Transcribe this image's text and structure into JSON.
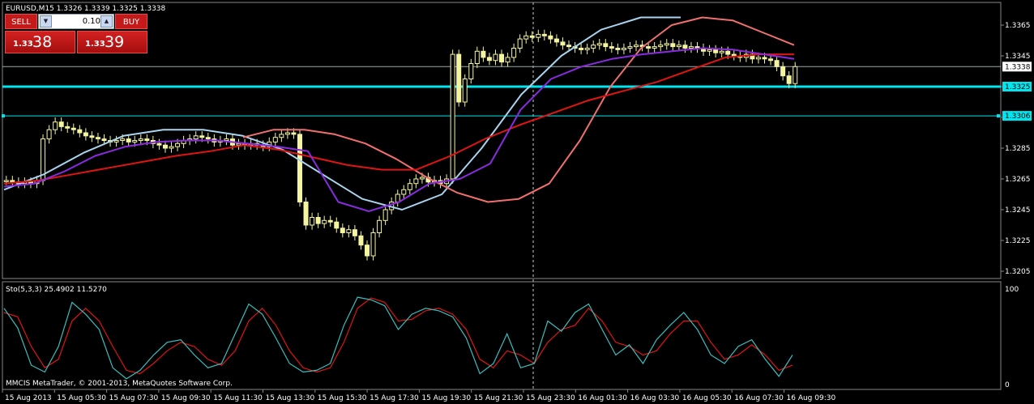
{
  "header": {
    "symbol_info": "EURUSD,M15  1.3326 1.3339 1.3325 1.3338"
  },
  "trade_panel": {
    "sell_label": "SELL",
    "buy_label": "BUY",
    "lot_value": "0.10",
    "sell_price_small": "1.33",
    "sell_price_big": "38",
    "buy_price_small": "1.33",
    "buy_price_big": "39"
  },
  "price_axis": {
    "ticks": [
      "1.3365",
      "1.3345",
      "1.3325",
      "1.3305",
      "1.3285",
      "1.3265",
      "1.3245",
      "1.3225",
      "1.3205"
    ],
    "tick_values": [
      1.3365,
      1.3345,
      1.3325,
      1.3305,
      1.3285,
      1.3265,
      1.3245,
      1.3225,
      1.3205
    ],
    "range": [
      1.32,
      1.3375
    ],
    "current_price_label": "1.3338",
    "current_price": 1.3338,
    "hline_1_label": "1.3325",
    "hline_1": 1.3325,
    "hline_2_label": "1.3306",
    "hline_2": 1.3306
  },
  "time_axis": {
    "labels": [
      "15 Aug 2013",
      "15 Aug 05:30",
      "15 Aug 07:30",
      "15 Aug 09:30",
      "15 Aug 11:30",
      "15 Aug 13:30",
      "15 Aug 15:30",
      "15 Aug 17:30",
      "15 Aug 19:30",
      "15 Aug 21:30",
      "15 Aug 23:30",
      "16 Aug 01:30",
      "16 Aug 03:30",
      "16 Aug 05:30",
      "16 Aug 07:30",
      "16 Aug 09:30"
    ]
  },
  "subwindow": {
    "indicator_label": "Sto(5,3,3) 25.4902 11.5270",
    "max_label": "100",
    "min_label": "0",
    "copyright": "MMCIS MetaTrader, © 2001-2013, MetaQuotes Software Corp."
  },
  "colors": {
    "background": "#000000",
    "candles": "#f5f5a0",
    "ma_fast": "#8a2be2",
    "ma_slow": "#e01414",
    "ma_smooth_light": "#a8d4f0",
    "ma_smooth_warm": "#f07070",
    "hline": "#00e5ee",
    "grid": "#888888",
    "sto_main": "#3bbfbf",
    "sto_signal": "#e01414"
  },
  "chart_data": {
    "type": "candlestick",
    "candle_close": [
      1.3264,
      1.3263,
      1.3262,
      1.3263,
      1.3262,
      1.3264,
      1.3291,
      1.3297,
      1.3302,
      1.3299,
      1.3298,
      1.3297,
      1.3295,
      1.3293,
      1.3292,
      1.3291,
      1.329,
      1.3289,
      1.329,
      1.3291,
      1.3289,
      1.329,
      1.3291,
      1.329,
      1.3288,
      1.3287,
      1.3285,
      1.3286,
      1.3288,
      1.329,
      1.3291,
      1.3293,
      1.3292,
      1.3291,
      1.3289,
      1.329,
      1.3291,
      1.3287,
      1.3288,
      1.3287,
      1.3288,
      1.3287,
      1.3286,
      1.3289,
      1.3292,
      1.3294,
      1.3295,
      1.3294,
      1.325,
      1.3235,
      1.324,
      1.3236,
      1.3238,
      1.3237,
      1.3233,
      1.323,
      1.3232,
      1.3228,
      1.3222,
      1.3215,
      1.323,
      1.3238,
      1.3245,
      1.325,
      1.3255,
      1.3258,
      1.3262,
      1.3265,
      1.3266,
      1.3263,
      1.3264,
      1.3262,
      1.3265,
      1.3346,
      1.3315,
      1.333,
      1.334,
      1.3348,
      1.3344,
      1.3342,
      1.3346,
      1.3341,
      1.3344,
      1.335,
      1.3356,
      1.3358,
      1.3357,
      1.3359,
      1.3358,
      1.3356,
      1.3354,
      1.3352,
      1.3351,
      1.335,
      1.3349,
      1.335,
      1.3352,
      1.3353,
      1.3351,
      1.335,
      1.3349,
      1.335,
      1.3351,
      1.3352,
      1.3351,
      1.335,
      1.3351,
      1.3352,
      1.3353,
      1.3351,
      1.3352,
      1.335,
      1.3351,
      1.335,
      1.3348,
      1.3349,
      1.3347,
      1.3348,
      1.3346,
      1.3345,
      1.3344,
      1.3346,
      1.3343,
      1.3344,
      1.3343,
      1.3342,
      1.3338,
      1.3332,
      1.3327,
      1.3338
    ],
    "ma_fast": [
      1.326,
      1.3262,
      1.327,
      1.328,
      1.3286,
      1.3289,
      1.329,
      1.329,
      1.3288,
      1.3286,
      1.3283,
      1.325,
      1.3244,
      1.325,
      1.3262,
      1.3265,
      1.3275,
      1.331,
      1.333,
      1.3338,
      1.3343,
      1.3346,
      1.3348,
      1.335,
      1.3349,
      1.3346,
      1.3343
    ],
    "ma_slow": [
      1.3262,
      1.3264,
      1.3268,
      1.3272,
      1.3276,
      1.328,
      1.3283,
      1.3287,
      1.3284,
      1.3279,
      1.3274,
      1.3271,
      1.3271,
      1.328,
      1.3291,
      1.33,
      1.3308,
      1.3316,
      1.3322,
      1.3328,
      1.3336,
      1.3344,
      1.3346,
      1.3346
    ],
    "stochastic_main": [
      85,
      62,
      18,
      10,
      40,
      92,
      78,
      60,
      15,
      2,
      12,
      30,
      45,
      48,
      30,
      15,
      20,
      55,
      90,
      78,
      50,
      20,
      10,
      12,
      20,
      65,
      98,
      95,
      88,
      60,
      78,
      85,
      82,
      75,
      50,
      8,
      20,
      55,
      15,
      20,
      70,
      58,
      80,
      90,
      60,
      30,
      42,
      20,
      48,
      65,
      80,
      60,
      30,
      20,
      40,
      48,
      25,
      5,
      30
    ],
    "stochastic_signal": [
      80,
      75,
      40,
      15,
      25,
      70,
      85,
      70,
      40,
      12,
      8,
      20,
      35,
      45,
      40,
      25,
      18,
      35,
      70,
      85,
      65,
      35,
      15,
      10,
      15,
      45,
      85,
      97,
      92,
      70,
      72,
      82,
      85,
      78,
      60,
      25,
      15,
      35,
      30,
      20,
      45,
      60,
      65,
      85,
      70,
      45,
      40,
      30,
      35,
      55,
      70,
      70,
      45,
      25,
      30,
      42,
      30,
      12,
      18
    ]
  }
}
